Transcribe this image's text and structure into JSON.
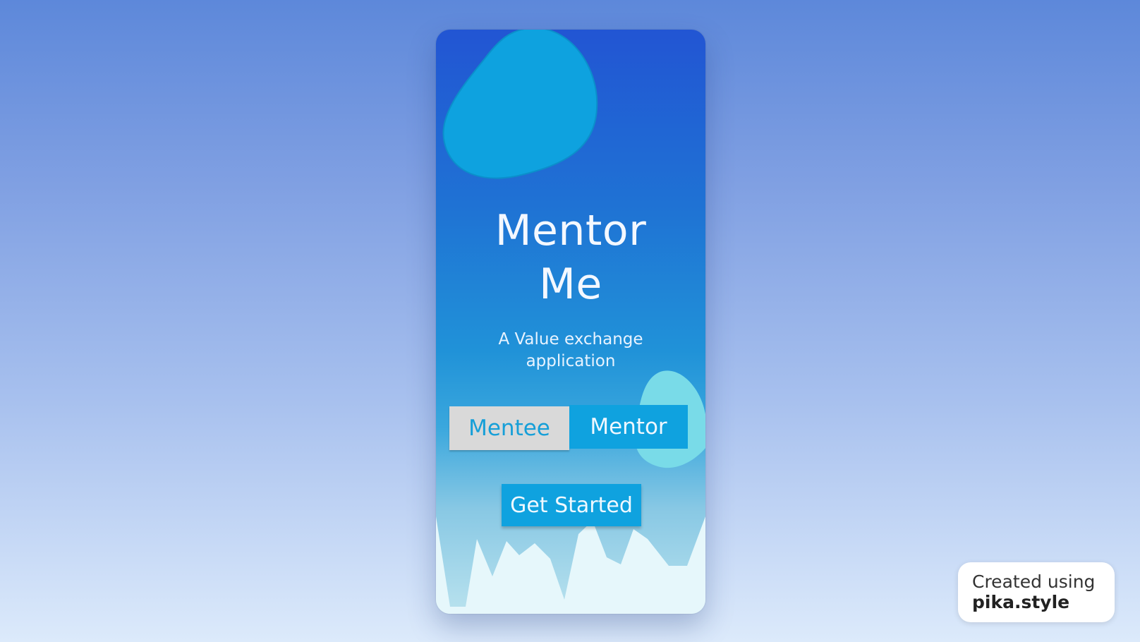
{
  "app": {
    "title": "Mentor Me",
    "title_lines": [
      "Mentor",
      "Me"
    ],
    "subtitle_lines": [
      "A Value exchange",
      "application"
    ]
  },
  "roles": {
    "mentee_label": "Mentee",
    "mentor_label": "Mentor",
    "selected": "Mentor"
  },
  "actions": {
    "get_started_label": "Get Started"
  },
  "watermark": {
    "line1": "Created using",
    "line2": "pika.style"
  },
  "colors": {
    "background_top": "#5d88da",
    "background_bottom": "#dceafb",
    "phone_top": "#2255d3",
    "accent": "#0fa2df",
    "unselected_button": "#d9d9d9",
    "decor_blob": "#0ea2df",
    "decor_blob_light": "#79dbe8",
    "mountains": "#e6f7fb"
  },
  "icons": [
    "blob-decoration",
    "blob-decoration-small",
    "mountain-silhouette"
  ]
}
